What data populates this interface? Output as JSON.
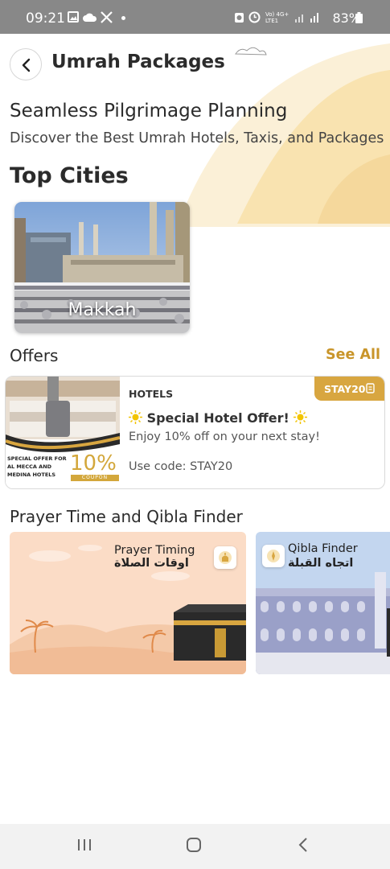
{
  "status_bar": {
    "time": "09:21",
    "battery": "83%",
    "network": "Vo) 4G+ LTE1",
    "icons": [
      "gallery-icon",
      "cloud-icon",
      "x-icon",
      "dot-icon",
      "alarm-icon",
      "clock-icon",
      "signal-icon",
      "battery-icon"
    ]
  },
  "header": {
    "title": "Umrah Packages",
    "back_icon": "chevron-left-icon"
  },
  "hero": {
    "title": "Seamless Pilgrimage Planning",
    "subtitle": "Discover the Best Umrah Hotels, Taxis, and Packages"
  },
  "top_cities": {
    "heading": "Top Cities",
    "cities": [
      {
        "name": "Makkah"
      }
    ]
  },
  "offers": {
    "heading": "Offers",
    "see_all": "See All",
    "items": [
      {
        "category": "HOTELS",
        "code_badge": "STAY20",
        "title": "Special Hotel Offer!",
        "description": "Enjoy 10% off on your next stay!",
        "use_code": "Use code: STAY20",
        "image_text": {
          "small": "SPECIAL OFFER FOR AL MECCA AND MEDINA HOTELS",
          "percent": "10%",
          "coupon": "COUPON"
        }
      }
    ]
  },
  "prayer": {
    "heading": "Prayer Time and Qibla Finder",
    "cards": [
      {
        "title": "Prayer Timing",
        "title_ar": "اوقات الصلاة"
      },
      {
        "title": "Qibla Finder",
        "title_ar": "اتجاه القبلة"
      }
    ]
  },
  "nav_bar": {
    "buttons": [
      "recents-icon",
      "home-icon",
      "back-icon"
    ]
  },
  "colors": {
    "accent": "#c9952a",
    "badge": "#d8a640",
    "status_bar": "#888888"
  }
}
